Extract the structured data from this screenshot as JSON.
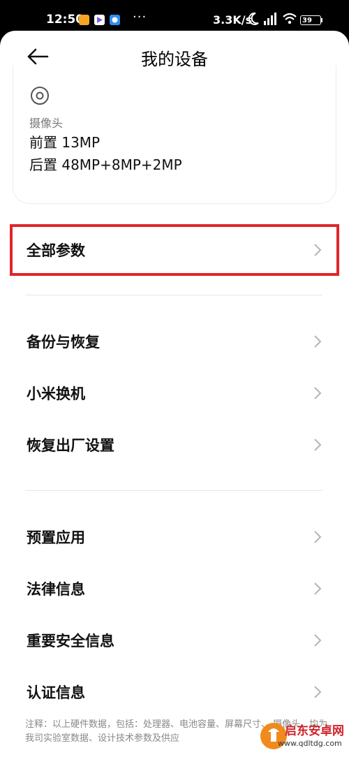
{
  "status": {
    "time": "12:50",
    "dots": "···",
    "speed": "3.3K/s",
    "battery": "39"
  },
  "header": {
    "title": "我的设备"
  },
  "camera": {
    "label": "摄像头",
    "front": "前置 13MP",
    "rear": "后置 48MP+8MP+2MP"
  },
  "sections": [
    {
      "items": [
        {
          "label": "全部参数"
        }
      ]
    },
    {
      "items": [
        {
          "label": "备份与恢复"
        },
        {
          "label": "小米换机"
        },
        {
          "label": "恢复出厂设置"
        }
      ]
    },
    {
      "items": [
        {
          "label": "预置应用"
        },
        {
          "label": "法律信息"
        },
        {
          "label": "重要安全信息"
        },
        {
          "label": "认证信息"
        }
      ]
    }
  ],
  "note": "注释：以上硬件数据，包括：处理器、电池容量、屏幕尺寸、 摄像头，均为我司实验室数据、设计技术参数及供应",
  "watermark": {
    "name": "启东安卓网",
    "url": "www.qdltdg.com"
  },
  "colors": {
    "highlight": "#e0262b",
    "accent_orange": "#f08a1d"
  }
}
